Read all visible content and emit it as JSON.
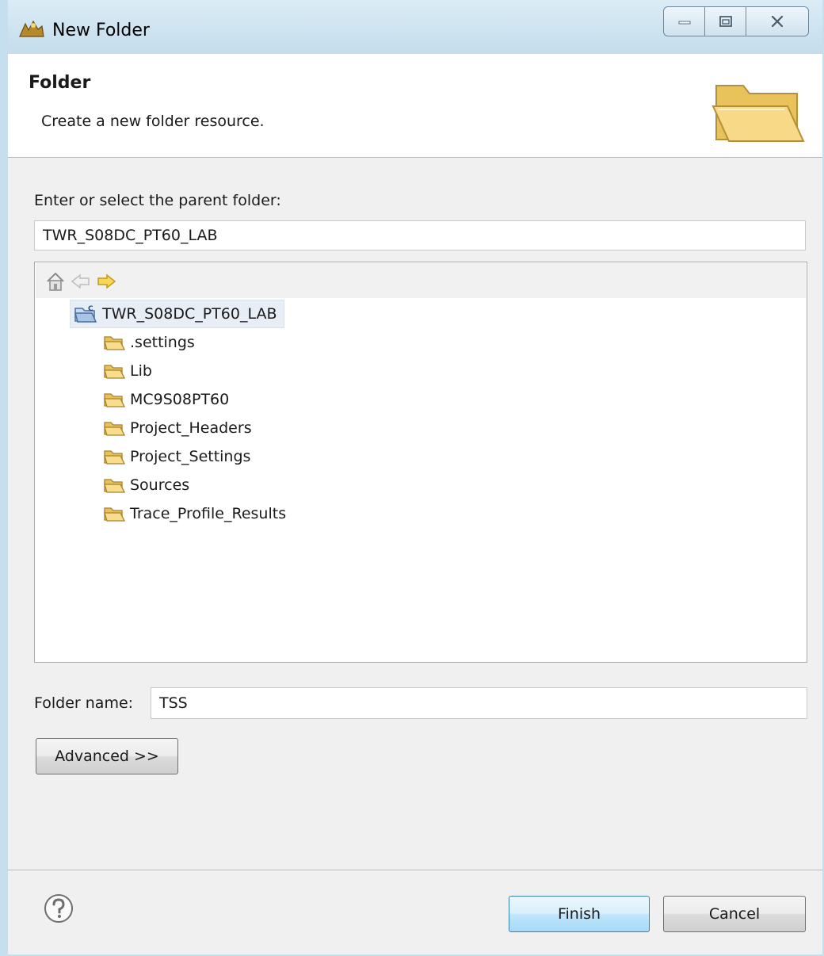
{
  "window": {
    "title": "New Folder",
    "icons": {
      "app": "eclipse-wizard-icon",
      "minimize": "minimize-icon",
      "maximize": "maximize-icon",
      "close": "close-icon"
    }
  },
  "header": {
    "title": "Folder",
    "description": "Create a new folder resource.",
    "icon": "folder-large-icon"
  },
  "parent": {
    "label": "Enter or select the parent folder:",
    "value": "TWR_S08DC_PT60_LAB"
  },
  "tree": {
    "toolbar_icons": [
      "home-icon",
      "back-arrow-icon",
      "forward-arrow-icon"
    ],
    "root": {
      "label": "TWR_S08DC_PT60_LAB",
      "icon": "c-project-folder-icon",
      "selected": true
    },
    "children": [
      {
        "label": ".settings",
        "icon": "folder-icon"
      },
      {
        "label": "Lib",
        "icon": "folder-icon"
      },
      {
        "label": "MC9S08PT60",
        "icon": "folder-icon"
      },
      {
        "label": "Project_Headers",
        "icon": "folder-icon"
      },
      {
        "label": "Project_Settings",
        "icon": "folder-icon"
      },
      {
        "label": "Sources",
        "icon": "folder-icon"
      },
      {
        "label": "Trace_Profile_Results",
        "icon": "folder-icon"
      }
    ]
  },
  "folder_name": {
    "label": "Folder name:",
    "value": "TSS"
  },
  "buttons": {
    "advanced": "Advanced >>",
    "finish": "Finish",
    "cancel": "Cancel"
  },
  "colors": {
    "titlebar": "#c4dcec",
    "folder": "#f5cf6a",
    "selection": "#e7eef5",
    "finish_button": "#bee6fd"
  }
}
